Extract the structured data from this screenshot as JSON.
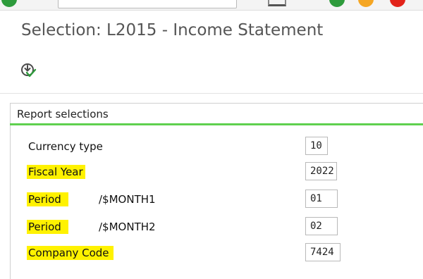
{
  "header": {
    "title": "Selection: L2015 - Income Statement"
  },
  "toolbar": {
    "icons": [
      "enter-icon",
      "command-field",
      "layout-icon",
      "green-status-icon",
      "yellow-status-icon",
      "red-status-icon"
    ],
    "colors": {
      "green": "#2e9b3c",
      "yellow": "#f5a623",
      "red": "#e2231a"
    }
  },
  "actions": {
    "execute_icon": "execute-icon"
  },
  "section": {
    "title": "Report selections",
    "accent": "#5fd04f"
  },
  "fields": [
    {
      "label": "Currency type",
      "tech": "",
      "value": "10",
      "highlighted": false
    },
    {
      "label": "Fiscal Year",
      "tech": "",
      "value": "2022",
      "highlighted": true
    },
    {
      "label": "Period",
      "tech": "/$MONTH1",
      "value": "01",
      "highlighted": true
    },
    {
      "label": "Period",
      "tech": "/$MONTH2",
      "value": "02",
      "highlighted": true
    },
    {
      "label": "Company Code",
      "tech": "",
      "value": "7424",
      "highlighted": true
    }
  ],
  "highlight_color": "#fff200"
}
